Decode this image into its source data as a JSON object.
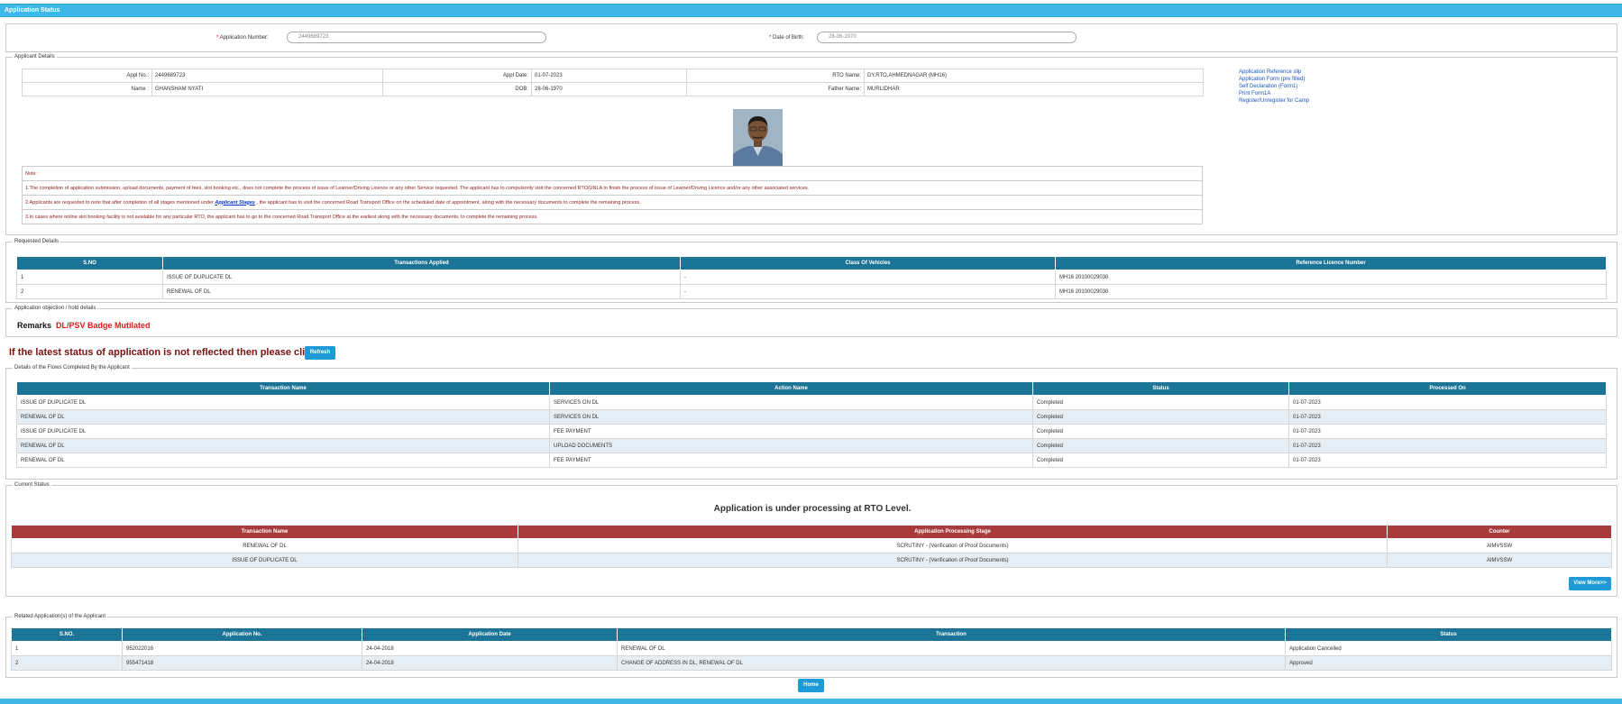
{
  "page": {
    "title": "Application Status"
  },
  "search": {
    "app_no_label": "Application Number:",
    "app_no_value": "2449689723",
    "dob_label": "Date of Birth:",
    "dob_value": "28-06-1970"
  },
  "applicant": {
    "legend": "Applicant Details",
    "appl_no_label": "Appl No.:",
    "appl_no": "2449689723",
    "appl_date_label": "Appl Date:",
    "appl_date": "01-07-2023",
    "rto_label": "RTO Name:",
    "rto": "DY.RTO,AHMEDNAGAR (MH16)",
    "name_label": "Name :",
    "name": "GHANSHAM NYATI",
    "dob_label": "DOB:",
    "dob": "28-06-1970",
    "father_label": "Father Name:",
    "father": "MURLIDHAR",
    "links": [
      "Application Reference slip",
      "Application Form (pre filled)",
      "Self Declaration (Form1)",
      "Print Form1A",
      "Register/Unregister for Camp"
    ],
    "note_title": "Note :",
    "note1": "1.The completion of application submission, upload documents, payment of fees, slot booking etc., does not complete the process of issue of Learner/Driving Licence or any other Service requested. The applicant has to compulsorily visit the concerned RTO/UNLA to finish the process of issue of Learner/Driving Licence and/or any other associated services.",
    "note2_a": "2.Applicants are requested to note that after completion of all stages mentioned under ",
    "note2_link": "Applicant Stages",
    "note2_b": " , the applicant has to visit the concerned Road Transport Office on the scheduled date of appointment, along with the necessary documents to complete the remaining process.",
    "note3": "3.In cases where online slot booking facility is not available for any particular RTO, the applicant has to go to the concerned Road Transport Office at the earliest along with the necessary documents, to complete the remaining process."
  },
  "requested": {
    "legend": "Requested Details",
    "headers": [
      "S.NO",
      "Transactions Applied",
      "Class Of Vehicles",
      "Reference Licence Number"
    ],
    "rows": [
      [
        "1",
        "ISSUE OF DUPLICATE DL",
        "-",
        "MH16 20100029030"
      ],
      [
        "2",
        "RENEWAL OF DL",
        "-",
        "MH16 20100029030"
      ]
    ]
  },
  "objection": {
    "legend": "Application objection / hold details",
    "remarks_label": "Remarks",
    "remarks_sep": ":",
    "remarks_value": "DL/PSV Badge Mutilated"
  },
  "refresh": {
    "text": "If the latest status of application is not reflected then please click on",
    "button": "Refresh"
  },
  "flows": {
    "legend": "Details of the Flows Completed By the Applicant",
    "headers": [
      "Transaction Name",
      "Action Name",
      "Status",
      "Processed On"
    ],
    "rows": [
      [
        "ISSUE OF DUPLICATE DL",
        "SERVICES ON DL",
        "Completed",
        "01-07-2023"
      ],
      [
        "RENEWAL OF DL",
        "SERVICES ON DL",
        "Completed",
        "01-07-2023"
      ],
      [
        "ISSUE OF DUPLICATE DL",
        "FEE PAYMENT",
        "Completed",
        "01-07-2023"
      ],
      [
        "RENEWAL OF DL",
        "UPLOAD DOCUMENTS",
        "Completed",
        "01-07-2023"
      ],
      [
        "RENEWAL OF DL",
        "FEE PAYMENT",
        "Completed",
        "01-07-2023"
      ]
    ]
  },
  "current": {
    "legend": "Current Status",
    "heading": "Application is under processing at RTO Level.",
    "headers": [
      "Transaction Name",
      "Application Processing Stage",
      "Counter"
    ],
    "rows": [
      [
        "RENEWAL OF DL",
        "SCRUTINY - (Verification of Proof Documents)",
        "AIMVSSW"
      ],
      [
        "ISSUE OF DUPLICATE DL",
        "SCRUTINY - (Verification of Proof Documents)",
        "AIMVSSW"
      ]
    ],
    "view_more": "View More>>"
  },
  "related": {
    "legend": "Related Application(s) of the Applicant",
    "headers": [
      "S.NO.",
      "Application No.",
      "Application Date",
      "Transaction",
      "Status"
    ],
    "rows": [
      [
        "1",
        "952022016",
        "24-04-2018",
        "RENEWAL OF DL",
        "Application Cancelled"
      ],
      [
        "2",
        "955471418",
        "24-04-2018",
        "CHANGE OF ADDRESS IN DL, RENEWAL OF DL",
        "Approved"
      ]
    ]
  },
  "home_button": "Home",
  "colors": {
    "header_blue": "#1c7597",
    "status_red": "#a83b3b",
    "title_bar": "#3fb8e8",
    "button": "#1e9ad6"
  }
}
